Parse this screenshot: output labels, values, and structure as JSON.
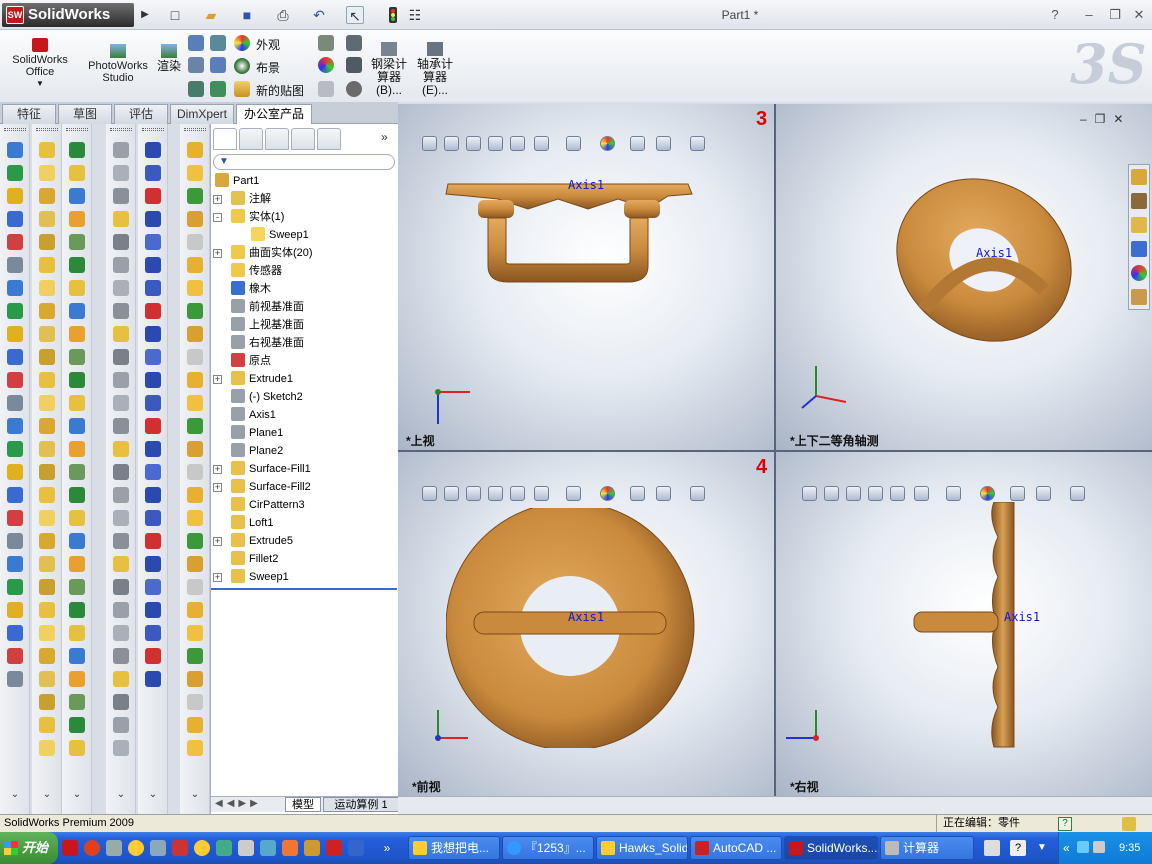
{
  "app": {
    "brand": "SolidWorks",
    "window_title": "Part1 *",
    "help_icon": "?"
  },
  "ribbon": {
    "solidworks_office": "SolidWorks\nOffice",
    "photoworks_studio": "PhotoWorks\nStudio",
    "render": "渲染",
    "appearance": "外观",
    "scene": "布景",
    "new_decal": "新的贴图",
    "beam_calc": "钢梁计\n算器\n(B)...",
    "bearing_calc": "轴承计\n算器\n(E)..."
  },
  "tabs": [
    {
      "label": "特征",
      "active": false
    },
    {
      "label": "草图",
      "active": false
    },
    {
      "label": "评估",
      "active": false
    },
    {
      "label": "DimXpert",
      "active": false
    },
    {
      "label": "办公室产品",
      "active": true
    }
  ],
  "tree": [
    {
      "label": "Part1",
      "expand": "",
      "indent": 0,
      "icon": "part-icon",
      "color": "#d9a83c"
    },
    {
      "label": "注解",
      "expand": "+",
      "indent": 1,
      "icon": "annotation-icon",
      "color": "#e3c24f"
    },
    {
      "label": "实体(1)",
      "expand": "-",
      "indent": 1,
      "icon": "solid-bodies-icon",
      "color": "#f0c94a"
    },
    {
      "label": "Sweep1",
      "expand": "",
      "indent": 2,
      "icon": "body-icon",
      "color": "#f5d55c"
    },
    {
      "label": "曲面实体(20)",
      "expand": "+",
      "indent": 1,
      "icon": "surface-bodies-icon",
      "color": "#f0c94a"
    },
    {
      "label": "传感器",
      "expand": "",
      "indent": 1,
      "icon": "sensor-icon",
      "color": "#f0c94a"
    },
    {
      "label": "橡木",
      "expand": "",
      "indent": 1,
      "icon": "material-icon",
      "color": "#3a6fd0"
    },
    {
      "label": "前视基准面",
      "expand": "",
      "indent": 1,
      "icon": "plane-icon",
      "color": "#9aa0a8"
    },
    {
      "label": "上视基准面",
      "expand": "",
      "indent": 1,
      "icon": "plane-icon",
      "color": "#9aa0a8"
    },
    {
      "label": "右视基准面",
      "expand": "",
      "indent": 1,
      "icon": "plane-icon",
      "color": "#9aa0a8"
    },
    {
      "label": "原点",
      "expand": "",
      "indent": 1,
      "icon": "origin-icon",
      "color": "#d24040"
    },
    {
      "label": "Extrude1",
      "expand": "+",
      "indent": 1,
      "icon": "extrude-icon",
      "color": "#e8c04a"
    },
    {
      "label": "(-) Sketch2",
      "expand": "",
      "indent": 1,
      "icon": "sketch-icon",
      "color": "#9aa0a8"
    },
    {
      "label": "Axis1",
      "expand": "",
      "indent": 1,
      "icon": "axis-icon",
      "color": "#9aa0a8"
    },
    {
      "label": "Plane1",
      "expand": "",
      "indent": 1,
      "icon": "plane-icon",
      "color": "#9aa0a8"
    },
    {
      "label": "Plane2",
      "expand": "",
      "indent": 1,
      "icon": "plane-icon",
      "color": "#9aa0a8"
    },
    {
      "label": "Surface-Fill1",
      "expand": "+",
      "indent": 1,
      "icon": "surface-fill-icon",
      "color": "#e8c04a"
    },
    {
      "label": "Surface-Fill2",
      "expand": "+",
      "indent": 1,
      "icon": "surface-fill-icon",
      "color": "#e8c04a"
    },
    {
      "label": "CirPattern3",
      "expand": "",
      "indent": 1,
      "icon": "circular-pattern-icon",
      "color": "#e8c04a"
    },
    {
      "label": "Loft1",
      "expand": "",
      "indent": 1,
      "icon": "loft-icon",
      "color": "#e8c04a"
    },
    {
      "label": "Extrude5",
      "expand": "+",
      "indent": 1,
      "icon": "extrude-icon",
      "color": "#e8c04a"
    },
    {
      "label": "Fillet2",
      "expand": "",
      "indent": 1,
      "icon": "fillet-icon",
      "color": "#e8c04a"
    },
    {
      "label": "Sweep1",
      "expand": "+",
      "indent": 1,
      "icon": "sweep-icon",
      "color": "#e8c04a"
    }
  ],
  "fm_bottom_tabs": [
    "模型",
    "运动算例 1"
  ],
  "viewports": {
    "top": {
      "label": "*上视",
      "number": "3",
      "axis": "Axis1"
    },
    "iso": {
      "label": "*上下二等角轴测",
      "axis": "Axis1"
    },
    "front": {
      "label": "*前视",
      "number": "4",
      "axis": "Axis1"
    },
    "right": {
      "label": "*右视",
      "axis": "Axis1"
    }
  },
  "status": {
    "left": "SolidWorks Premium 2009",
    "right": "正在编辑：零件"
  },
  "taskbar": {
    "start": "开始",
    "buttons": [
      "我想把电...",
      "『1253』...",
      "Hawks_Solid",
      "AutoCAD ...",
      "SolidWorks...",
      "计算器"
    ],
    "clock": "9:35"
  },
  "colors": {
    "wood": "#c98a3d",
    "wood_dark": "#8a5520",
    "axis_blue": "#1515d6",
    "view_number_red": "#e00000"
  }
}
